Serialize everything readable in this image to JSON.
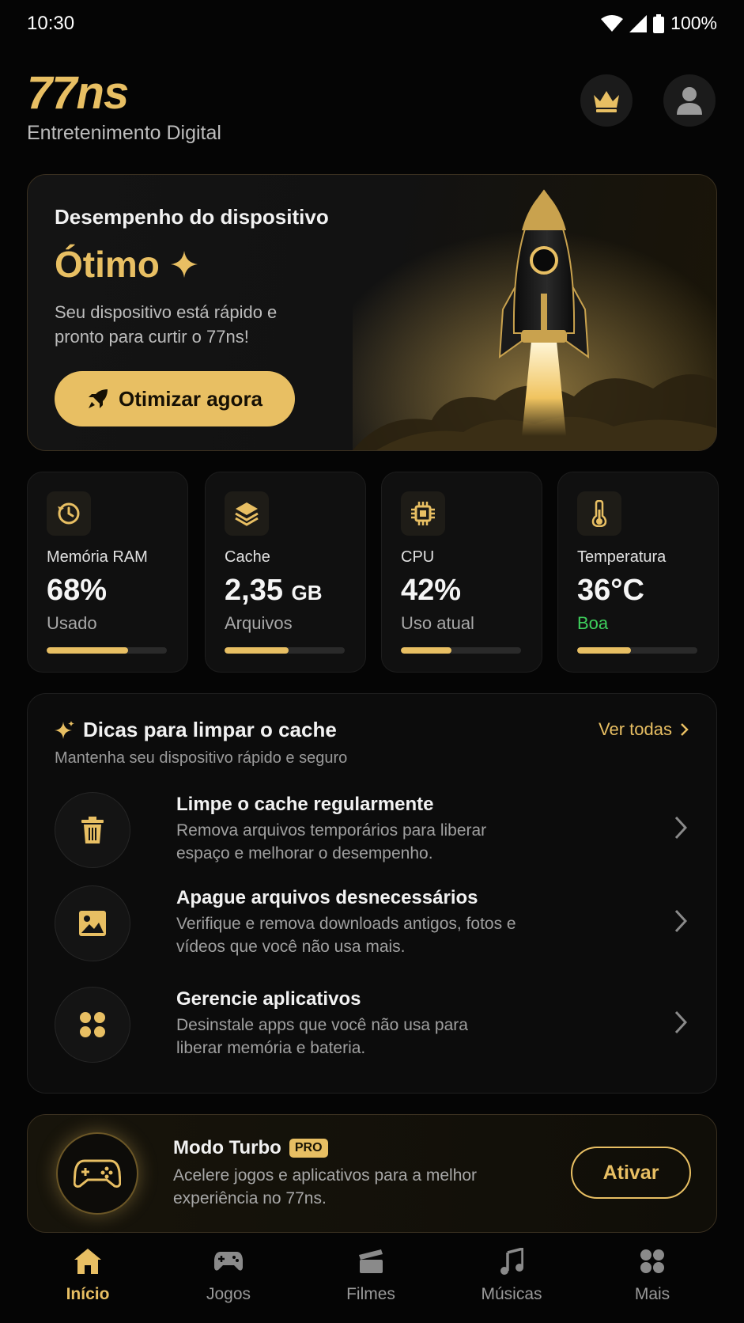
{
  "status_bar": {
    "time": "10:30",
    "battery": "100%"
  },
  "header": {
    "logo": "77ns",
    "subtitle": "Entretenimento Digital"
  },
  "hero": {
    "heading": "Desempenho do dispositivo",
    "rating": "Ótimo",
    "description": "Seu dispositivo está rápido e pronto para curtir o 77ns!",
    "button_label": "Otimizar agora"
  },
  "stats": [
    {
      "label": "Memória RAM",
      "value": "68%",
      "unit": "",
      "sub": "Usado",
      "progress": 0.68,
      "icon": "history-icon"
    },
    {
      "label": "Cache",
      "value": "2,35",
      "unit": "GB",
      "sub": "Arquivos",
      "progress": 0.53,
      "icon": "layers-icon"
    },
    {
      "label": "CPU",
      "value": "42%",
      "unit": "",
      "sub": "Uso atual",
      "progress": 0.42,
      "icon": "chip-icon"
    },
    {
      "label": "Temperatura",
      "value": "36°C",
      "unit": "",
      "sub": "Boa",
      "progress": 0.45,
      "icon": "thermometer-icon"
    }
  ],
  "tips": {
    "title": "Dicas para limpar o cache",
    "see_all": "Ver todas",
    "description": "Mantenha seu dispositivo rápido e seguro",
    "items": [
      {
        "title": "Limpe o cache regularmente",
        "text": "Remova arquivos temporários para liberar espaço e melhorar o desempenho.",
        "icon": "trash-icon"
      },
      {
        "title": "Apague arquivos desnecessários",
        "text": "Verifique e remova downloads antigos, fotos e vídeos que você não usa mais.",
        "icon": "image-icon"
      },
      {
        "title": "Gerencie aplicativos",
        "text": "Desinstale apps que você não usa para liberar memória e bateria.",
        "icon": "apps-icon"
      }
    ]
  },
  "turbo": {
    "title": "Modo Turbo",
    "badge": "PRO",
    "text": "Acelere jogos e aplicativos para a melhor experiência no 77ns.",
    "button_label": "Ativar"
  },
  "nav": [
    {
      "label": "Início",
      "icon": "home-icon",
      "active": true
    },
    {
      "label": "Jogos",
      "icon": "gamepad-icon",
      "active": false
    },
    {
      "label": "Filmes",
      "icon": "clapperboard-icon",
      "active": false
    },
    {
      "label": "Músicas",
      "icon": "music-icon",
      "active": false
    },
    {
      "label": "Mais",
      "icon": "grid-icon",
      "active": false
    }
  ],
  "colors": {
    "accent": "#e8bf63",
    "background": "#050505",
    "good": "#3ecf5c"
  }
}
